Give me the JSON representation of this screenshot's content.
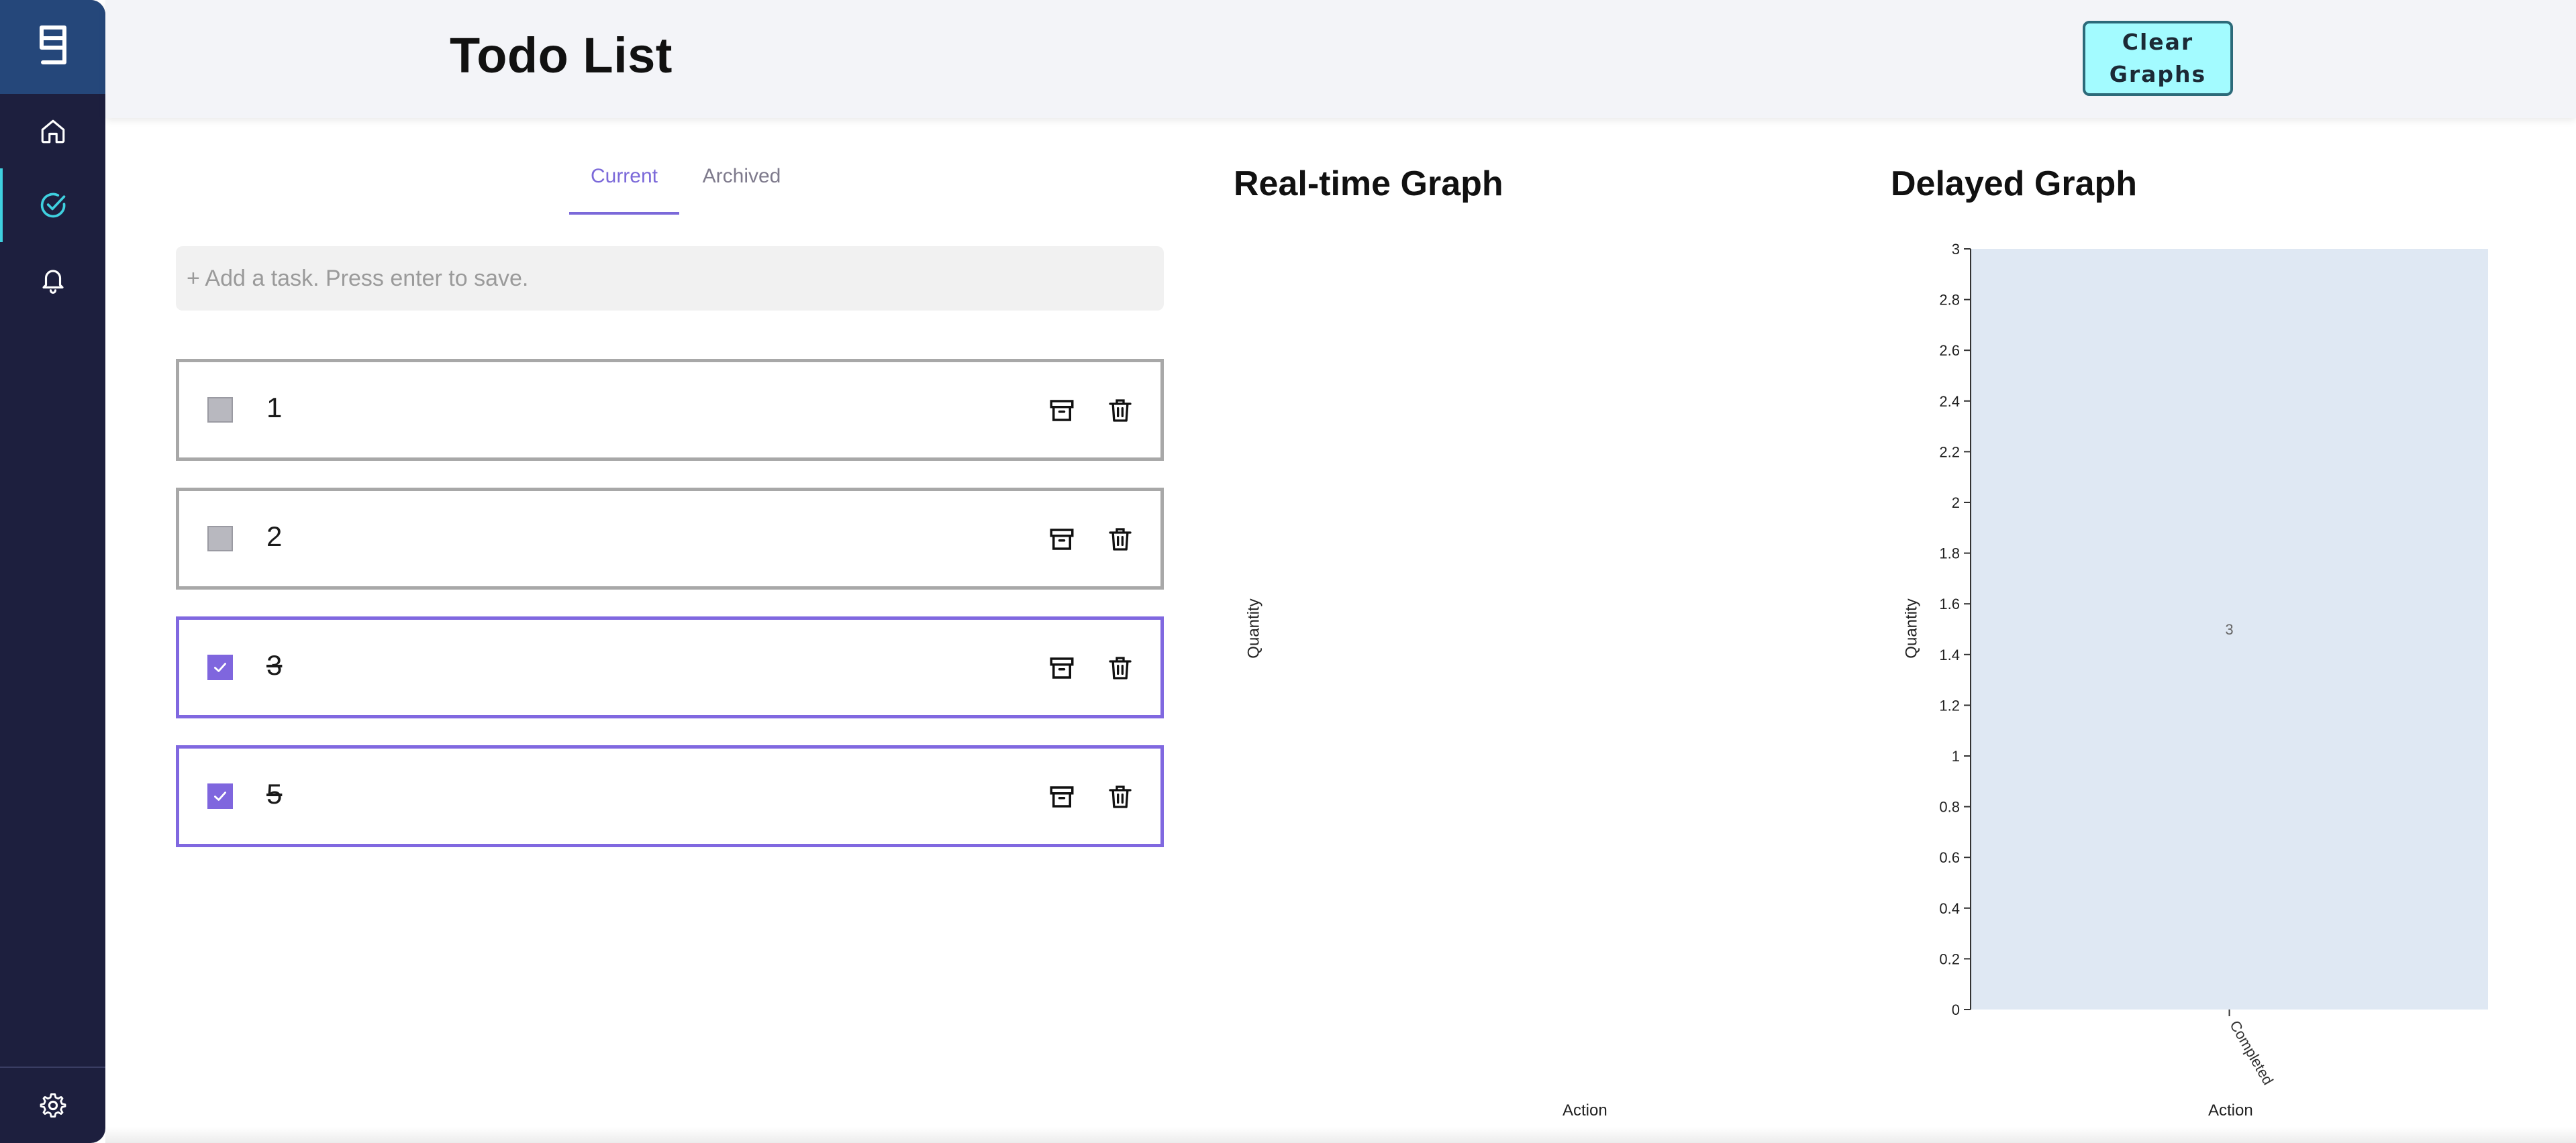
{
  "header": {
    "title": "Todo List",
    "clear_button_label": "Clear\nGraphs"
  },
  "sidebar": {
    "items": [
      {
        "name": "logo",
        "icon": "logo-icon"
      },
      {
        "name": "home",
        "icon": "home-icon"
      },
      {
        "name": "todos",
        "icon": "check-circle-icon",
        "active": true
      },
      {
        "name": "notifications",
        "icon": "bell-icon"
      },
      {
        "name": "settings",
        "icon": "gear-icon"
      }
    ]
  },
  "tabs": [
    {
      "label": "Current",
      "active": true
    },
    {
      "label": "Archived",
      "active": false
    }
  ],
  "add_task": {
    "placeholder": "+ Add a task. Press enter to save.",
    "value": ""
  },
  "todos": [
    {
      "text": "1",
      "completed": false
    },
    {
      "text": "2",
      "completed": false
    },
    {
      "text": "3",
      "completed": true
    },
    {
      "text": "5",
      "completed": true
    }
  ],
  "icons": {
    "archive": "archive-icon",
    "delete": "trash-icon",
    "check": "check-icon"
  },
  "colors": {
    "accent": "#7b69d9",
    "sidebar": "#1d1f3e",
    "clear_button": "#a3fbff",
    "bar_fill": "#dfe8f3"
  },
  "realtime_graph": {
    "title": "Real-time Graph",
    "ylabel": "Quantity",
    "xlabel": "Action"
  },
  "delayed_graph": {
    "title": "Delayed Graph",
    "ylabel": "Quantity",
    "xlabel": "Action"
  },
  "chart_data": [
    {
      "type": "bar",
      "title": "Real-time Graph",
      "xlabel": "Action",
      "ylabel": "Quantity",
      "categories": [],
      "values": []
    },
    {
      "type": "bar",
      "title": "Delayed Graph",
      "xlabel": "Action",
      "ylabel": "Quantity",
      "categories": [
        "Completed"
      ],
      "values": [
        3
      ],
      "data_labels": [
        "3"
      ],
      "ylim": [
        0,
        3
      ],
      "yticks": [
        0,
        0.2,
        0.4,
        0.6,
        0.8,
        1,
        1.2,
        1.4,
        1.6,
        1.8,
        2,
        2.2,
        2.4,
        2.6,
        2.8,
        3
      ],
      "ytick_labels": [
        "0",
        "0.2",
        "0.4",
        "0.6",
        "0.8",
        "1",
        "1.2",
        "1.4",
        "1.6",
        "1.8",
        "2",
        "2.2",
        "2.4",
        "2.6",
        "2.8",
        "3"
      ],
      "grid": false
    }
  ]
}
